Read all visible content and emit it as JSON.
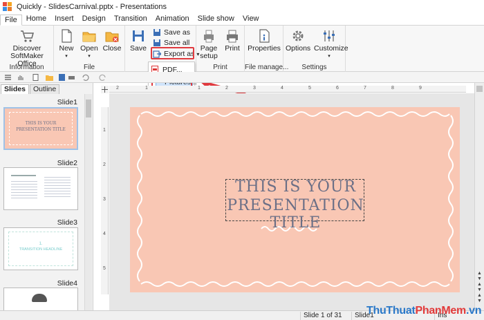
{
  "window": {
    "title": "Quickly - SlidesCarnival.pptx - Presentations"
  },
  "menu": [
    "File",
    "Home",
    "Insert",
    "Design",
    "Transition",
    "Animation",
    "Slide show",
    "View"
  ],
  "ribbon": {
    "information": {
      "label": "Information",
      "discover_line1": "Discover",
      "discover_line2": "SoftMaker Office"
    },
    "file": {
      "label": "File",
      "new": "New",
      "open": "Open",
      "close": "Close"
    },
    "document": {
      "label": "D",
      "save": "Save",
      "save_as": "Save as",
      "save_all": "Save all",
      "export_as": "Export as"
    },
    "print": {
      "label": "Print",
      "page_setup_line1": "Page",
      "page_setup_line2": "setup",
      "print": "Print"
    },
    "file_manager": {
      "label": "File manage...",
      "properties": "Properties"
    },
    "settings": {
      "label": "Settings",
      "options": "Options",
      "customize": "Customize"
    }
  },
  "dropdown": {
    "pdf": "PDF...",
    "pictures": "Pictures..."
  },
  "panel": {
    "tabs": [
      "Slides",
      "Outline"
    ],
    "slides": [
      "Slide1",
      "Slide2",
      "Slide3",
      "Slide4"
    ],
    "thumb1_line1": "THIS IS YOUR",
    "thumb1_line2": "PRESENTATION TITLE",
    "thumb3_line1": "1.",
    "thumb3_line2": "TRANSITION HEADLINE"
  },
  "ruler": {
    "h": [
      "2",
      "1",
      "1",
      "2",
      "3",
      "4",
      "5",
      "6",
      "7",
      "8",
      "9"
    ],
    "v": [
      "1",
      "2",
      "3",
      "4",
      "5"
    ]
  },
  "slide": {
    "title_line1": "THIS IS YOUR",
    "title_line2": "PRESENTATION TITLE"
  },
  "status": {
    "position": "Slide 1 of 31",
    "slide_name": "Slide1",
    "mode": "Ins"
  },
  "watermark": {
    "part1": "ThuThuat",
    "part2": "PhanMem",
    "part3": ".vn"
  },
  "colors": {
    "slide_bg": "#f9c7b4",
    "accent_red": "#e0393e",
    "title_text": "#6b6f86",
    "selection_blue": "#cfe4fb"
  }
}
